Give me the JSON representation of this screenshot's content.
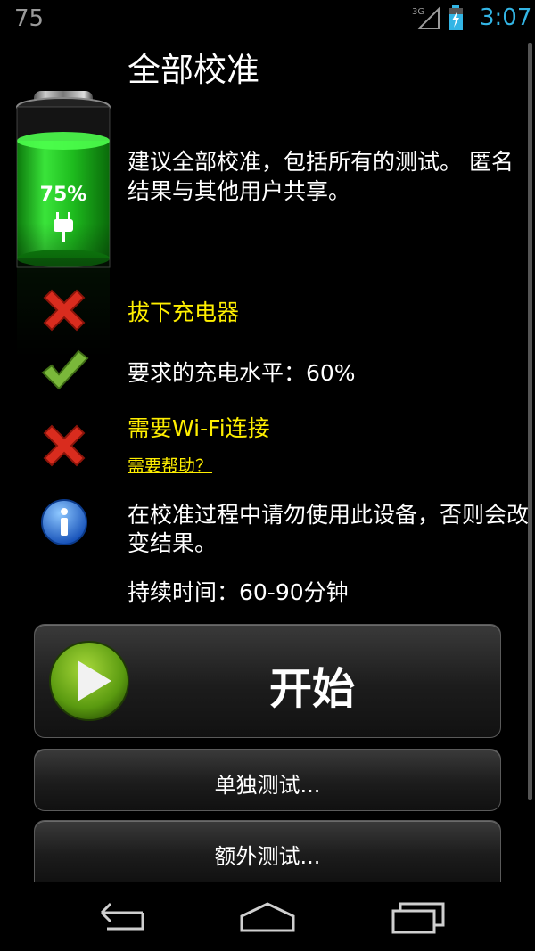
{
  "status_bar": {
    "notification_number": "75",
    "network": "3G",
    "time": "3:07"
  },
  "page": {
    "title": "全部校准",
    "description": "建议全部校准，包括所有的测试。 匿名结果与其他用户共享。",
    "battery": {
      "percent_label": "75%",
      "level": 0.75,
      "charging": true
    }
  },
  "requirements": [
    {
      "icon": "red-x-icon",
      "label": "拔下充电器",
      "status": "fail"
    },
    {
      "icon": "green-check-icon",
      "label": "要求的充电水平：60%",
      "status": "ok"
    },
    {
      "icon": "red-x-icon",
      "label": "需要Wi-Fi连接",
      "status": "fail",
      "help": "需要帮助？"
    }
  ],
  "info": {
    "icon": "info-icon",
    "text": "在校准过程中请勿使用此设备，否则会改变结果。",
    "duration": "持续时间：60-90分钟"
  },
  "buttons": {
    "start": "开始",
    "single_test": "单独测试...",
    "extra_test": "额外测试..."
  },
  "colors": {
    "warning": "#ffef00",
    "clock": "#33b5e5",
    "battery_green": "#2ad12a"
  },
  "navbar": [
    "back-icon",
    "home-icon",
    "recent-apps-icon"
  ]
}
